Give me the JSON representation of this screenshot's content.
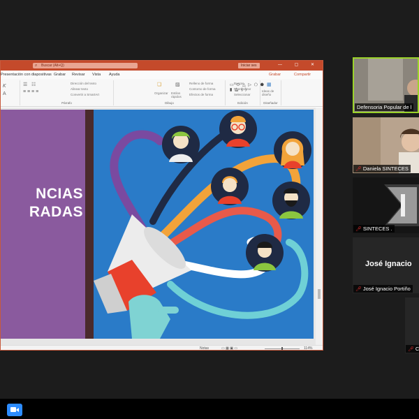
{
  "window": {
    "title": "Presentación con diapositivas",
    "search_placeholder": "Buscar (Alt+Q)",
    "signin": "Iniciar ses",
    "controls": "— ▢ ✕"
  },
  "menu": {
    "items": [
      "Presentación con diapositivas",
      "Grabar",
      "Revisar",
      "Vista",
      "Ayuda"
    ],
    "grabar_right": "Grabar",
    "share_right": "Compartir"
  },
  "ribbon": {
    "paragraph": {
      "label": "Párrafo",
      "lines": [
        "Dirección del texto",
        "Alinear texto",
        "Convertir a SmartArt"
      ]
    },
    "drawing": {
      "label": "Dibujo",
      "shapes": "▭ ⬭ △ ▷ ⬠ ⬟ ▮ ⧋ ⟨ ⟩",
      "arrange": "Organizar",
      "styles": "Estilos rápidos",
      "fill": "Relleno de forma",
      "outline": "Contorno de forma",
      "effects": "Efectos de forma"
    },
    "editing": {
      "label": "Edición",
      "find": "Buscar",
      "replace": "Reemplazar",
      "select": "Seleccionar"
    },
    "designer": {
      "label": "Diseñador",
      "ideas": "Ideas de diseño"
    }
  },
  "slide": {
    "title_line1": "NCIAS",
    "title_line2": "RADAS"
  },
  "status": {
    "notes": "Notas",
    "zoom": "114%"
  },
  "participants": [
    {
      "name": "Defensoria Popular de l",
      "muted": false,
      "active": true
    },
    {
      "name": "Daniela SINTECES",
      "muted": true,
      "active": false
    },
    {
      "name": "SINTECES .",
      "muted": true,
      "active": false
    },
    {
      "name": "José Ignacio Portiño",
      "display_name": "José Ignacio",
      "muted": true,
      "active": false
    },
    {
      "name": "C",
      "muted": true,
      "active": false
    }
  ],
  "colors": {
    "accent_ppt": "#c44a2b",
    "slide_purple": "#8a5a9e",
    "slide_blue": "#2a7bc8",
    "active_speaker": "#9bd32a",
    "zoom_blue": "#2d8cff"
  },
  "icons": [
    "search-icon",
    "mic-muted-icon",
    "megaphone-icon",
    "zoom-app-icon"
  ]
}
